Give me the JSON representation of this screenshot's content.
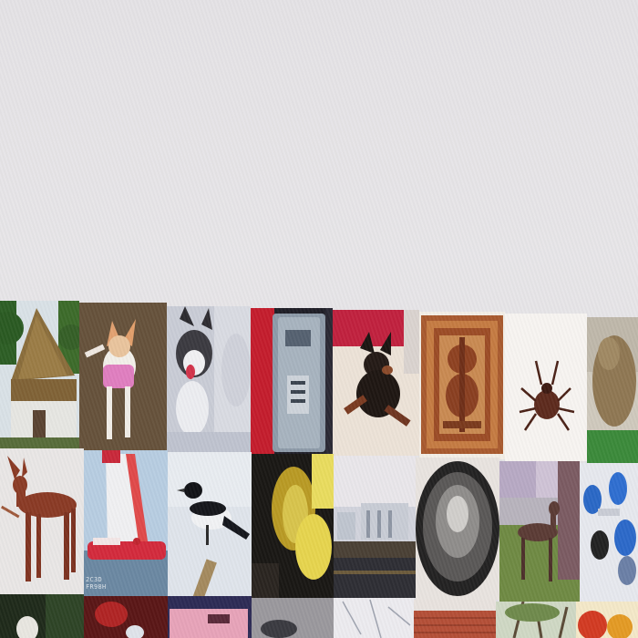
{
  "image": {
    "kind": "photo of a monitor showing a grid of thumbnail images",
    "tiles": [
      {
        "id": "r1c0",
        "subject": "thatched-cottage"
      },
      {
        "id": "r1c1",
        "subject": "chihuahua-in-pink-vest"
      },
      {
        "id": "r1c2",
        "subject": "husky-in-snow"
      },
      {
        "id": "r1c3",
        "subject": "parking-meter"
      },
      {
        "id": "r1c4",
        "subject": "black-dog-lying"
      },
      {
        "id": "r1c5",
        "subject": "ornate-carved-panel"
      },
      {
        "id": "r1c6",
        "subject": "tick-insect"
      },
      {
        "id": "r1c7",
        "subject": "shaggy-dog"
      },
      {
        "id": "r2c0",
        "subject": "pharaoh-hound"
      },
      {
        "id": "r2c1",
        "subject": "red-sailboat"
      },
      {
        "id": "r2c2",
        "subject": "magpie-on-post"
      },
      {
        "id": "r2c3",
        "subject": "yellow-object"
      },
      {
        "id": "r2c4",
        "subject": "harbor-buildings"
      },
      {
        "id": "r2c5",
        "subject": "metal-bowl"
      },
      {
        "id": "r2c6",
        "subject": "greyhound-on-grass"
      },
      {
        "id": "r2c7",
        "subject": "blue-dumbbells"
      },
      {
        "id": "r3c0",
        "subject": "bird-in-green"
      },
      {
        "id": "r3c1",
        "subject": "red-flowers"
      },
      {
        "id": "r3c2",
        "subject": "pink-signboard"
      },
      {
        "id": "r3c3",
        "subject": "grey-scene"
      },
      {
        "id": "r3c4",
        "subject": "paper-map"
      },
      {
        "id": "r3c5",
        "subject": "roof-tiles"
      },
      {
        "id": "r3c6",
        "subject": "trees"
      },
      {
        "id": "r3c7",
        "subject": "fruit"
      }
    ],
    "watermark_text": "2C3D\nFR98H"
  }
}
